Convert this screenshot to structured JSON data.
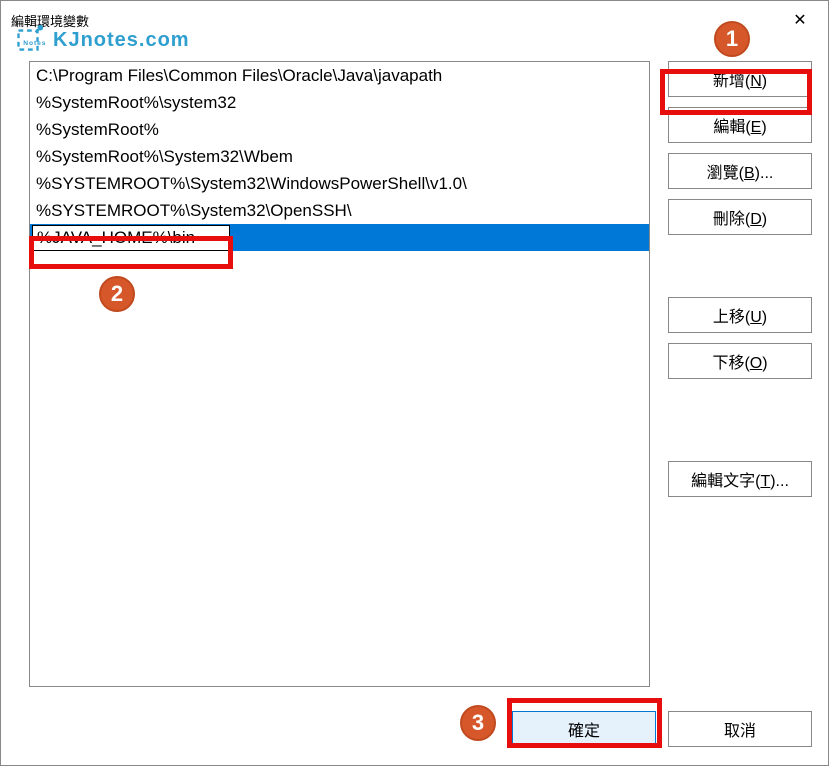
{
  "window": {
    "title": "編輯環境變數",
    "close_glyph": "✕"
  },
  "watermark": {
    "text": "KJnotes.com"
  },
  "path_list": {
    "items": [
      {
        "value": "C:\\Program Files\\Common Files\\Oracle\\Java\\javapath",
        "selected": false
      },
      {
        "value": "%SystemRoot%\\system32",
        "selected": false
      },
      {
        "value": "%SystemRoot%",
        "selected": false
      },
      {
        "value": "%SystemRoot%\\System32\\Wbem",
        "selected": false
      },
      {
        "value": "%SYSTEMROOT%\\System32\\WindowsPowerShell\\v1.0\\",
        "selected": false
      },
      {
        "value": "%SYSTEMROOT%\\System32\\OpenSSH\\",
        "selected": false
      },
      {
        "value": "%JAVA_HOME%\\bin",
        "selected": true,
        "editing": true
      }
    ]
  },
  "buttons": {
    "new": {
      "label": "新增(",
      "hotkey": "N",
      "suffix": ")"
    },
    "edit": {
      "label": "編輯(",
      "hotkey": "E",
      "suffix": ")"
    },
    "browse": {
      "label": "瀏覽(",
      "hotkey": "B",
      "suffix": ")..."
    },
    "delete": {
      "label": "刪除(",
      "hotkey": "D",
      "suffix": ")"
    },
    "move_up": {
      "label": "上移(",
      "hotkey": "U",
      "suffix": ")"
    },
    "move_down": {
      "label": "下移(",
      "hotkey": "O",
      "suffix": ")"
    },
    "edit_text": {
      "label": "編輯文字(",
      "hotkey": "T",
      "suffix": ")..."
    },
    "ok": "確定",
    "cancel": "取消"
  },
  "annotations": {
    "badges": {
      "1": "1",
      "2": "2",
      "3": "3"
    }
  }
}
